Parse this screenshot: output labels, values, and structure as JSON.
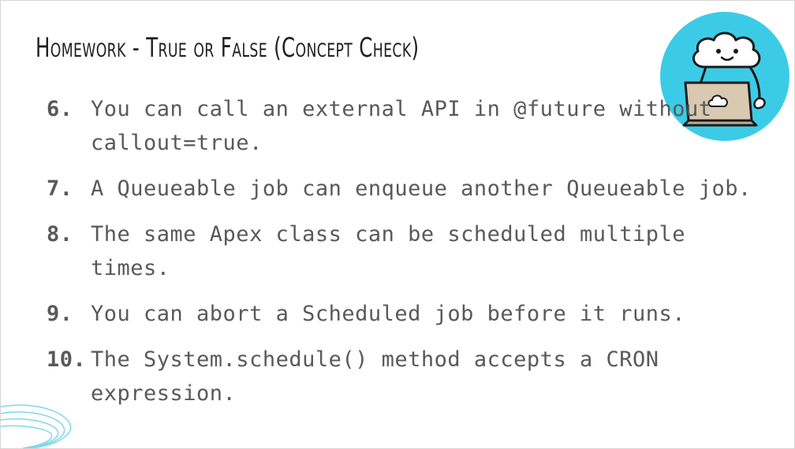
{
  "slide": {
    "title": "Homework - True or False (Concept Check)",
    "items": [
      {
        "number": "6.",
        "text": "You can call an external API in @future without callout=true."
      },
      {
        "number": "7.",
        "text": "A Queueable job can enqueue another Queueable job."
      },
      {
        "number": "8.",
        "text": "The same Apex class can be scheduled multiple times."
      },
      {
        "number": "9.",
        "text": "You can abort a Scheduled job before it runs."
      },
      {
        "number": "10.",
        "text": "The System.schedule() method accepts a CRON expression."
      }
    ]
  },
  "icons": {
    "avatar": "cloud-character-with-laptop-icon",
    "decoration": "swirl-lines-icon"
  },
  "colors": {
    "avatar_circle": "#3ccbe6",
    "laptop": "#d9c9b0",
    "text": "#595959",
    "title": "#1f1f1f",
    "swirl": "#7fd8ea"
  }
}
